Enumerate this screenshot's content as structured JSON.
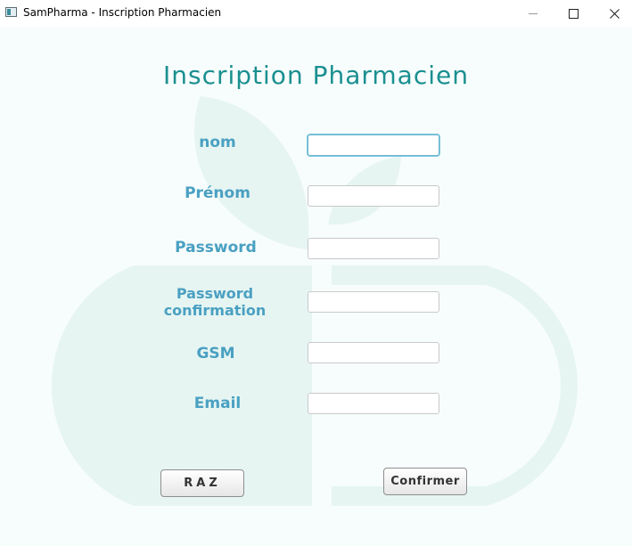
{
  "window": {
    "title": "SamPharma - Inscription Pharmacien",
    "controls": [
      "minimize-icon",
      "maximize-icon",
      "close-icon"
    ]
  },
  "form": {
    "heading": "Inscription Pharmacien",
    "fields": [
      {
        "label": "nom",
        "value": "",
        "focused": true
      },
      {
        "label": "Prénom",
        "value": ""
      },
      {
        "label": "Password",
        "value": ""
      },
      {
        "label": "Password confirmation",
        "value": ""
      },
      {
        "label": "GSM",
        "value": ""
      },
      {
        "label": "Email",
        "value": ""
      }
    ],
    "buttons": {
      "reset": "RAZ",
      "confirm": "Confirmer"
    }
  },
  "colors": {
    "heading": "#1b8f90",
    "label": "#4aa0c2",
    "background": "#f7fdfc",
    "background_art": "#e6f5f2"
  }
}
